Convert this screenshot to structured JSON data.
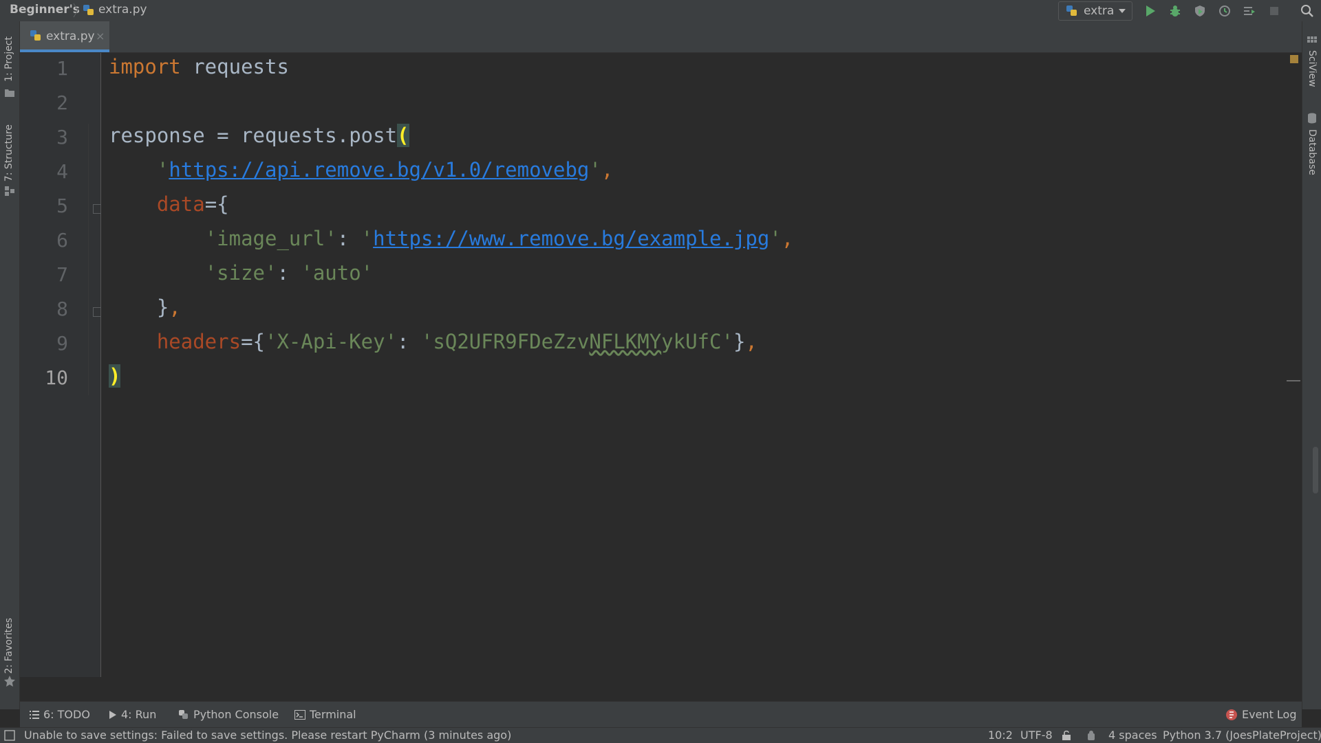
{
  "navbar": {
    "project": "Beginner's",
    "file": "extra.py",
    "run_config": "extra"
  },
  "left_tools": {
    "project": "1: Project",
    "structure": "7: Structure",
    "favorites": "2: Favorites"
  },
  "right_tools": {
    "sciview": "SciView",
    "database": "Database"
  },
  "tabs": [
    {
      "label": "extra.py"
    }
  ],
  "editor": {
    "line_numbers": [
      "1",
      "2",
      "3",
      "4",
      "5",
      "6",
      "7",
      "8",
      "9",
      "10"
    ],
    "active_line": "10",
    "code": {
      "l1_kw": "import",
      "l1_rest": " requests",
      "l3_text": "response = requests.post",
      "l3_paren": "(",
      "l4_q1": "'",
      "l4_url": "https://api.remove.bg/v1.0/removebg",
      "l4_q2": "'",
      "l4_comma": ",",
      "l5_param": "data",
      "l5_rest": "={",
      "l6_key": "'image_url'",
      "l6_colon": ": ",
      "l6_q1": "'",
      "l6_url": "https://www.remove.bg/example.jpg",
      "l6_q2": "'",
      "l6_comma": ",",
      "l7_key": "'size'",
      "l7_colon": ": ",
      "l7_val": "'auto'",
      "l8_brace": "}",
      "l8_comma": ",",
      "l9_param": "headers",
      "l9_eq": "={",
      "l9_key": "'X-Api-Key'",
      "l9_colon": ": ",
      "l9_val_a": "'sQ2UFR9FDeZzv",
      "l9_val_b": "NFLKMY",
      "l9_val_c": "ykUfC'",
      "l9_close": "}",
      "l9_comma": ",",
      "l10_paren": ")"
    }
  },
  "tool_windows": {
    "todo": "6: TODO",
    "run": "4: Run",
    "python_console": "Python Console",
    "terminal": "Terminal",
    "event_log": "Event Log"
  },
  "status": {
    "message": "Unable to save settings: Failed to save settings. Please restart PyCharm (3 minutes ago)",
    "position": "10:2",
    "encoding": "UTF-8",
    "indent": "4 spaces",
    "interpreter": "Python 3.7 (JoesPlateProject)"
  },
  "colors": {
    "background": "#2b2b2b",
    "keyword": "#cc7832",
    "string": "#6a8759",
    "url": "#287bde",
    "param": "#aa4926",
    "accent": "#4a88c7"
  }
}
